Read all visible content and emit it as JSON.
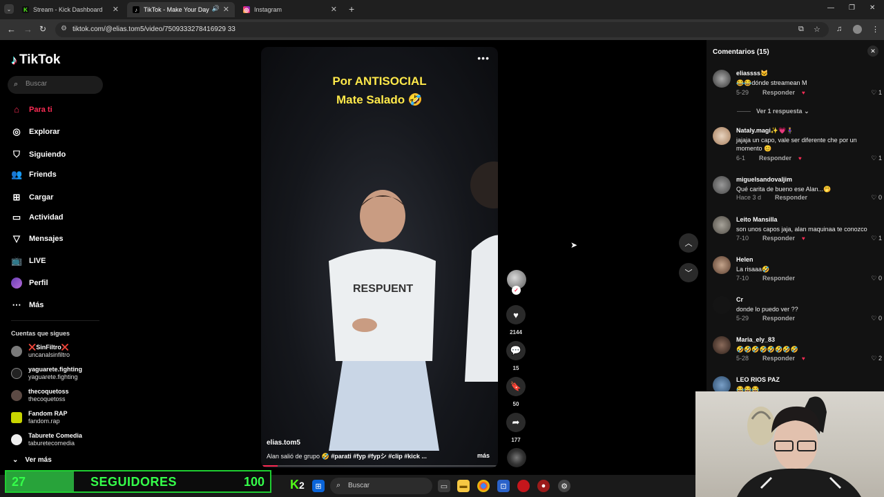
{
  "browser": {
    "tabs": [
      {
        "title": "Stream - Kick Dashboard",
        "favicon": "kick-icon",
        "color": "#53fc18"
      },
      {
        "title": "TikTok - Make Your Day",
        "favicon": "tiktok-icon",
        "color": "#ffffff",
        "active": true
      },
      {
        "title": "Instagram",
        "favicon": "instagram-icon",
        "color": "#e1306c"
      }
    ],
    "url": "tiktok.com/@elias.tom5/video/7509333278416929 33"
  },
  "sidebar": {
    "logo": "TikTok",
    "search_placeholder": "Buscar",
    "nav": [
      {
        "label": "Para ti",
        "icon": "home-icon"
      },
      {
        "label": "Explorar",
        "icon": "compass-icon"
      },
      {
        "label": "Siguiendo",
        "icon": "following-icon"
      },
      {
        "label": "Friends",
        "icon": "friends-icon"
      },
      {
        "label": "Cargar",
        "icon": "upload-icon"
      },
      {
        "label": "Actividad",
        "icon": "activity-icon"
      },
      {
        "label": "Mensajes",
        "icon": "messages-icon"
      },
      {
        "label": "LIVE",
        "icon": "live-icon"
      },
      {
        "label": "Perfil",
        "icon": "profile-avatar"
      },
      {
        "label": "Más",
        "icon": "more-icon"
      }
    ],
    "following_title": "Cuentas que sigues",
    "accounts": [
      {
        "name": "❌SinFiltro❌",
        "handle": "uncanalsinfiltro"
      },
      {
        "name": "yaguarete.fighting",
        "handle": "yaguarete.fighting"
      },
      {
        "name": "thecoquetoss",
        "handle": "thecoquetoss"
      },
      {
        "name": "Fandom RAP",
        "handle": "fandom.rap"
      },
      {
        "name": "Taburete Comedia",
        "handle": "taburetecomedia"
      }
    ],
    "see_more": "Ver más"
  },
  "video": {
    "caption_line1": "Por ANTISOCIAL",
    "caption_line2": "Mate Salado 🤣",
    "author": "elias.tom5",
    "description": "Alan salió de grupo 🤣 ",
    "hashtags": "#parati #fyp #fypシ #clip #kick ...",
    "more": "más",
    "progress": 0.07,
    "likes": "2144",
    "comments": "15",
    "saves": "50",
    "shares": "177"
  },
  "comments_panel": {
    "title": "Comentarios (15)",
    "view_replies": "Ver 1 respuesta",
    "reply_label": "Responder",
    "items": [
      {
        "user": "eliassss🐱",
        "text": "😂😂dónde streamean M",
        "date": "5-29",
        "likes": "1",
        "creator_liked": true
      },
      {
        "user": "Nataly.magi✨💗🧍‍♀️",
        "text": "jajaja un capo, vale ser diferente che por un momento 😊",
        "date": "6-1",
        "likes": "1",
        "creator_liked": true
      },
      {
        "user": "miguelsandovaljim",
        "text": "Qué carita de bueno ese Alan...🤭",
        "date": "Hace 3 d",
        "likes": "0",
        "creator_liked": false
      },
      {
        "user": "Leito Mansilla",
        "text": "son unos capos jaja, alan maquinaa te conozco",
        "date": "7-10",
        "likes": "1",
        "creator_liked": true
      },
      {
        "user": "Helen",
        "text": "La risaaa🤣",
        "date": "7-10",
        "likes": "0",
        "creator_liked": false
      },
      {
        "user": "Cr",
        "text": "donde lo puedo ver ??",
        "date": "5-29",
        "likes": "0",
        "creator_liked": false
      },
      {
        "user": "Maria_ely_83",
        "text": "🤣🤣🤣🤣🤣🤣🤣🤣",
        "date": "5-28",
        "likes": "2",
        "creator_liked": true
      },
      {
        "user": "LEO RIOS PAZ",
        "text": "😂😂😂",
        "date": "",
        "likes": "",
        "creator_liked": false
      }
    ]
  },
  "overlay": {
    "followers_current": "27",
    "followers_label": "SEGUIDORES",
    "followers_goal": "100",
    "kick_badge": "2"
  },
  "taskbar": {
    "search_placeholder": "Buscar"
  },
  "colors": {
    "accent": "#fe2c55",
    "kick_green": "#53fc18",
    "panel_bg": "#121212"
  }
}
